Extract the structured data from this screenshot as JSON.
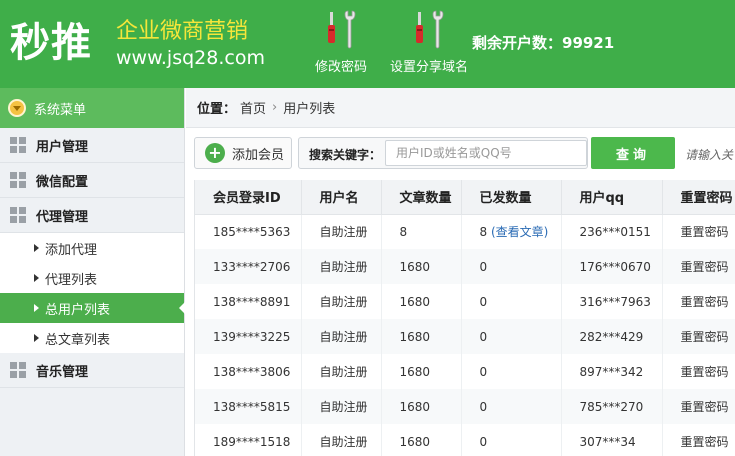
{
  "header": {
    "brand": "秒推",
    "slogan": "企业微商营销",
    "url": "www.jsq28.com",
    "tools": [
      {
        "label": "修改密码",
        "icon": "screwdriver-wrench-icon"
      },
      {
        "label": "设置分享域名",
        "icon": "screwdriver-wrench-icon"
      }
    ],
    "quota_label": "剩余开户数：99921",
    "brand_color": "#3fae49"
  },
  "sidebar": {
    "title": "系统菜单",
    "groups": [
      {
        "label": "用户管理"
      },
      {
        "label": "微信配置"
      },
      {
        "label": "代理管理",
        "items": [
          {
            "label": "添加代理"
          },
          {
            "label": "代理列表"
          },
          {
            "label": "总用户列表",
            "active": true
          },
          {
            "label": "总文章列表"
          }
        ]
      },
      {
        "label": "音乐管理"
      }
    ]
  },
  "breadcrumb": {
    "position_label": "位置：",
    "items": [
      "首页",
      "用户列表"
    ]
  },
  "toolbar": {
    "add_label": "添加会员",
    "search_label": "搜索关键字：",
    "search_placeholder": "用户ID或姓名或QQ号",
    "query_label": "查询",
    "hint": "请输入关"
  },
  "table": {
    "columns": [
      "会员登录ID",
      "用户名",
      "文章数量",
      "已发数量",
      "用户qq",
      "重置密码"
    ],
    "rows": [
      {
        "id": "185****5363",
        "name": "自助注册",
        "articles": "8",
        "sent": "8",
        "sent_link": "(查看文章)",
        "qq": "236***0151",
        "reset": "重置密码"
      },
      {
        "id": "133****2706",
        "name": "自助注册",
        "articles": "1680",
        "sent": "0",
        "sent_link": "",
        "qq": "176***0670",
        "reset": "重置密码"
      },
      {
        "id": "138****8891",
        "name": "自助注册",
        "articles": "1680",
        "sent": "0",
        "sent_link": "",
        "qq": "316***7963",
        "reset": "重置密码"
      },
      {
        "id": "139****3225",
        "name": "自助注册",
        "articles": "1680",
        "sent": "0",
        "sent_link": "",
        "qq": "282***429",
        "reset": "重置密码"
      },
      {
        "id": "138****3806",
        "name": "自助注册",
        "articles": "1680",
        "sent": "0",
        "sent_link": "",
        "qq": "897***342",
        "reset": "重置密码"
      },
      {
        "id": "138****5815",
        "name": "自助注册",
        "articles": "1680",
        "sent": "0",
        "sent_link": "",
        "qq": "785***270",
        "reset": "重置密码"
      },
      {
        "id": "189****1518",
        "name": "自助注册",
        "articles": "1680",
        "sent": "0",
        "sent_link": "",
        "qq": "307***34",
        "reset": "重置密码"
      }
    ]
  }
}
